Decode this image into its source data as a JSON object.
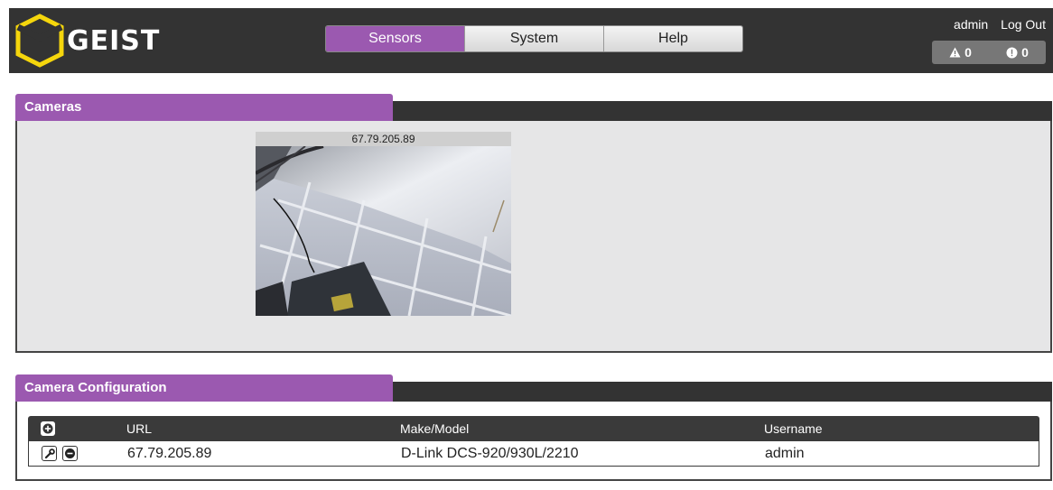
{
  "header": {
    "logo_text": "GEIST",
    "nav_tabs": [
      {
        "label": "Sensors",
        "active": true
      },
      {
        "label": "System",
        "active": false
      },
      {
        "label": "Help",
        "active": false
      }
    ],
    "user": "admin",
    "logout": "Log Out",
    "alarm_warnings": "0",
    "alarm_critical": "0"
  },
  "cameras_panel": {
    "title": "Cameras",
    "camera_label": "67.79.205.89"
  },
  "config_panel": {
    "title": "Camera Configuration",
    "columns": {
      "url": "URL",
      "make": "Make/Model",
      "username": "Username"
    },
    "rows": [
      {
        "url": "67.79.205.89",
        "make": "D-Link DCS-920/930L/2210",
        "username": "admin"
      }
    ]
  },
  "colors": {
    "accent": "#9b59b0",
    "header_bg": "#333333",
    "logo_yellow": "#f5d60c"
  },
  "icons": [
    "geist-logo-icon",
    "warning-icon",
    "alert-icon",
    "add-icon",
    "wrench-icon",
    "remove-icon"
  ]
}
